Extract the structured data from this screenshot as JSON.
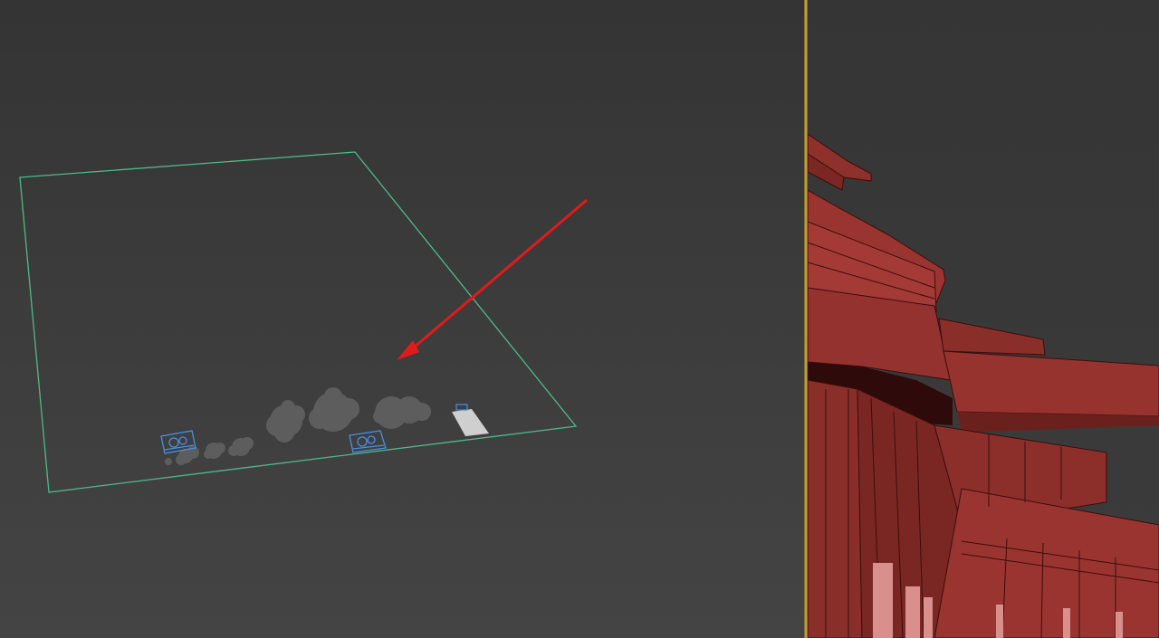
{
  "viewports": {
    "left": {
      "label": ""
    },
    "right": {
      "label": ""
    }
  },
  "colors": {
    "background_dark": "#343434",
    "grid_plane": "#4fb98a",
    "annotation_arrow": "#e01b1b",
    "selection_helper": "#4a8fe0",
    "proxy_tree": "#5c5c5c",
    "card_plane": "#cfcfcf",
    "building_red": "#8c2f2b",
    "building_dark": "#3a0e0c",
    "divider": "#c9a63a"
  },
  "scene_objects": {
    "plane": "ground-plane-gizmo",
    "trees": "tree-proxy-icon",
    "helpers": "camera-helper-icon",
    "arrow": "red-annotation-arrow",
    "building": "red-building-model"
  }
}
